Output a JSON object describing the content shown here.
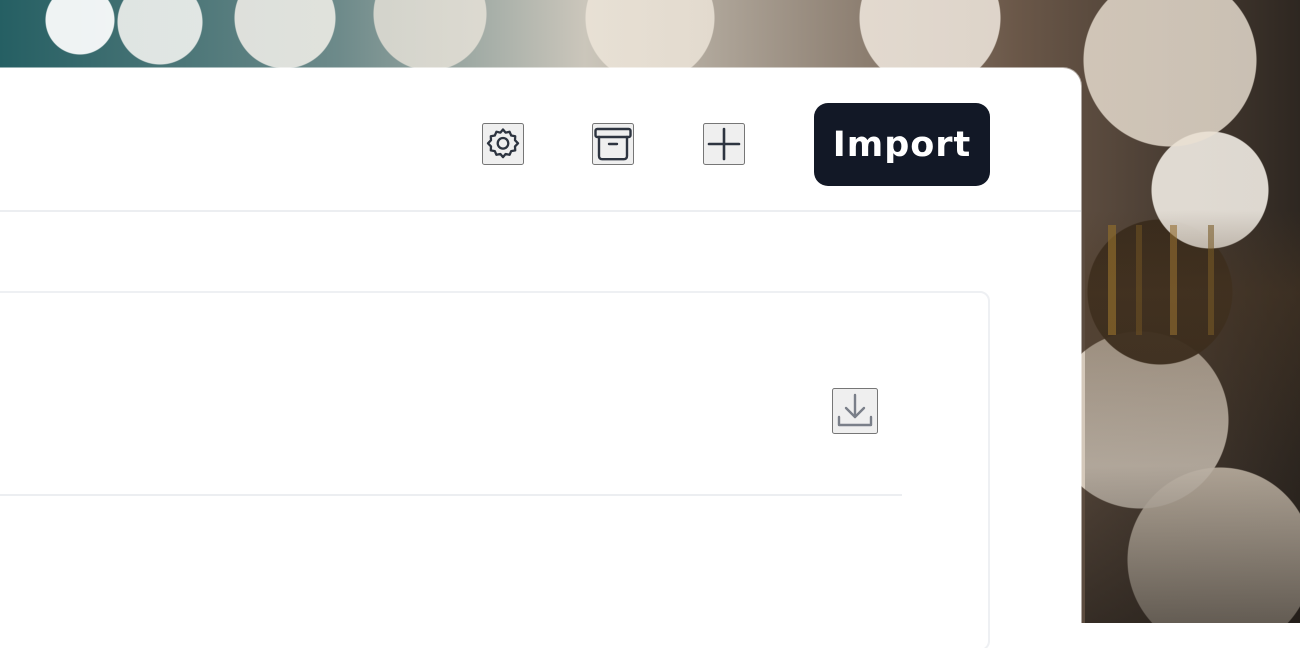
{
  "window": {
    "import_label": "Import"
  },
  "icons": {
    "settings": "gear-icon",
    "archive": "archive-icon",
    "add": "plus-icon",
    "download": "download-icon"
  },
  "colors": {
    "panel_background": "#ffffff",
    "primary_button": "#121826",
    "icon_dark": "#2d3440",
    "icon_muted": "#7a7f89",
    "divider": "#eceef1"
  }
}
